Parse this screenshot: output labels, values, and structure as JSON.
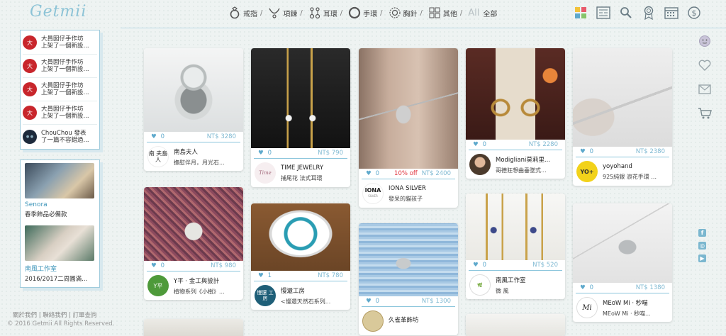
{
  "brand": {
    "logo_text": "Getmii"
  },
  "nav": {
    "items": [
      {
        "label": "戒指",
        "icon": "ring-icon"
      },
      {
        "label": "項鍊",
        "icon": "necklace-icon"
      },
      {
        "label": "耳環",
        "icon": "earring-icon"
      },
      {
        "label": "手環",
        "icon": "bracelet-icon"
      },
      {
        "label": "胸針",
        "icon": "brooch-icon"
      },
      {
        "label": "其他",
        "icon": "grid-icon"
      }
    ],
    "separator": "/",
    "all_big": "All",
    "all_label": "全部"
  },
  "activity": [
    {
      "text1": "大員囡仔手作坊",
      "text2": "上架了一個新設..."
    },
    {
      "text1": "大員囡仔手作坊",
      "text2": "上架了一個新設..."
    },
    {
      "text1": "大員囡仔手作坊",
      "text2": "上架了一個新設..."
    },
    {
      "text1": "大員囡仔手作坊",
      "text2": "上架了一個新設..."
    },
    {
      "text1": "ChouChou 發表",
      "text2": "了一篇不容錯過..."
    }
  ],
  "featured": [
    {
      "name": "Senora",
      "desc": "春季飾品必備款"
    },
    {
      "name": "南風工作室",
      "desc": "2016/2017二周圓滿..."
    }
  ],
  "footer": {
    "links": "關於我們 | 聯絡我們 | 訂單查詢",
    "copyright": "© 2016 Getmii All Rights Reserved."
  },
  "cards": [
    {
      "likes": "0",
      "price": "NT$ 3280",
      "shop": "南島夫人",
      "title": "撫慰伴月，月光石...",
      "discount": ""
    },
    {
      "likes": "0",
      "price": "NT$ 980",
      "shop": "Y平 · 金工與設計",
      "title": "植物系列《小樹》...",
      "discount": ""
    },
    {
      "likes": "0",
      "price": "NT$ 790",
      "shop": "TIME JEWELRY",
      "title": "捕尾花 法式耳環",
      "discount": ""
    },
    {
      "likes": "1",
      "price": "NT$ 780",
      "shop": "慢還工房",
      "title": "<慢還天然石系列...",
      "discount": ""
    },
    {
      "likes": "0",
      "price": "NT$ 2400",
      "shop": "IONA SILVER",
      "title": "發呆的貓孩子",
      "discount": "10% off"
    },
    {
      "likes": "0",
      "price": "NT$ 1300",
      "shop": "久雀革飾坊",
      "title": "",
      "discount": ""
    },
    {
      "likes": "0",
      "price": "NT$ 2280",
      "shop": "Modigliani莫莉里...",
      "title": "哥德狂想曲垂墜式...",
      "discount": ""
    },
    {
      "likes": "0",
      "price": "NT$ 520",
      "shop": "南風工作室",
      "title": "微 風",
      "discount": ""
    },
    {
      "likes": "0",
      "price": "NT$ 2380",
      "shop": "yoyohand",
      "title": "925純銀 浪花手環 ...",
      "discount": ""
    },
    {
      "likes": "0",
      "price": "NT$ 1380",
      "shop": "MEoW Mi · 秒喵",
      "title": "MEoW Mi · 秒喵...",
      "discount": ""
    }
  ],
  "avatar_text": {
    "nandao": "南 夫島人",
    "time": "Time",
    "iona": "IONA",
    "iona_sub": "SILVER",
    "manhuan": "慢還 工房",
    "yoyo": "YO+",
    "meow": "Mi",
    "ypin": "Y平"
  },
  "colors": {
    "accent": "#5ea9cc",
    "price": "#7fb9d2",
    "discount": "#e0323c",
    "border": "#9fcbdc"
  }
}
